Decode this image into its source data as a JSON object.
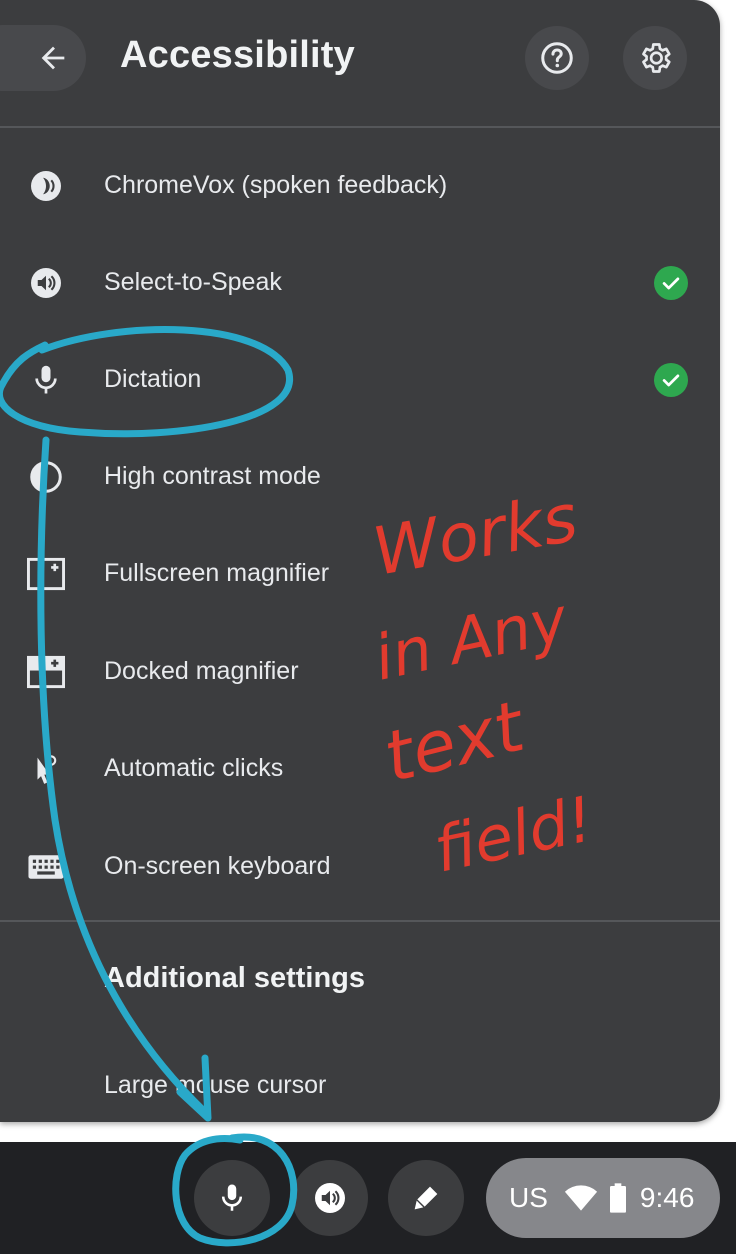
{
  "header": {
    "title": "Accessibility",
    "back_icon": "arrow-left-icon",
    "help_icon": "help-circle-icon",
    "settings_icon": "gear-icon"
  },
  "features": [
    {
      "label": "ChromeVox (spoken feedback)",
      "icon": "chromevox-icon",
      "enabled": false
    },
    {
      "label": "Select-to-Speak",
      "icon": "select-to-speak-icon",
      "enabled": true
    },
    {
      "label": "Dictation",
      "icon": "microphone-icon",
      "enabled": true
    },
    {
      "label": "High contrast mode",
      "icon": "contrast-icon",
      "enabled": false
    },
    {
      "label": "Fullscreen magnifier",
      "icon": "fullscreen-magnifier-icon",
      "enabled": false
    },
    {
      "label": "Docked magnifier",
      "icon": "docked-magnifier-icon",
      "enabled": false
    },
    {
      "label": "Automatic clicks",
      "icon": "cursor-click-icon",
      "enabled": false
    },
    {
      "label": "On-screen keyboard",
      "icon": "keyboard-icon",
      "enabled": false
    }
  ],
  "additional": {
    "title": "Additional settings",
    "items": [
      {
        "label": "Large mouse cursor"
      }
    ]
  },
  "shelf": {
    "dictation_icon": "microphone-icon",
    "select_to_speak_icon": "select-to-speak-icon",
    "stylus_icon": "stylus-icon",
    "status": {
      "keyboard_layout": "US",
      "time": "9:46",
      "wifi_icon": "wifi-icon",
      "battery_icon": "battery-icon"
    }
  },
  "annotation": {
    "handwritten_note": [
      "Works",
      "in Any",
      "text",
      "field!"
    ],
    "circle_color": "#29a9c9",
    "note_color": "#e23b2e"
  },
  "colors": {
    "panel": "#3c3d3f",
    "check": "#2ea84f",
    "shelf": "#202124"
  }
}
